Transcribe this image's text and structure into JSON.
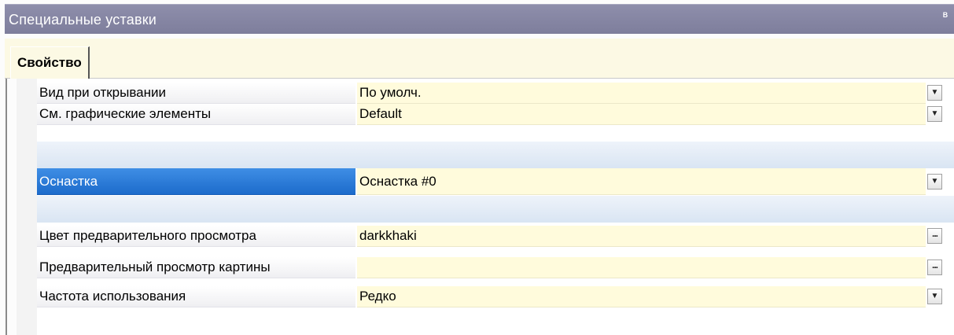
{
  "window": {
    "title": "Специальные уставки",
    "pin_icon": "pin-icon"
  },
  "tabs": [
    {
      "label": "Свойство"
    }
  ],
  "grid": {
    "rows": [
      {
        "name": "Вид при открывании",
        "value": "По умолч.",
        "button": "dropdown"
      },
      {
        "name": "См. графические элементы",
        "value": "Default",
        "button": "dropdown"
      },
      {
        "name": "Оснастка",
        "value": "Оснастка #0",
        "button": "dropdown",
        "selected": true
      },
      {
        "name": "Цвет предварительного просмотра",
        "value": "darkkhaki",
        "button": "ellipsis"
      },
      {
        "name": "Предварительный просмотр картины",
        "value": "",
        "button": "ellipsis"
      },
      {
        "name": "Частота использования",
        "value": "Редко",
        "button": "dropdown"
      }
    ]
  },
  "colors": {
    "titlebar": "#8484a2",
    "tabstrip": "#fcf9e4",
    "value_cell": "#fffbdc",
    "selected_row": "#2878d8",
    "separator": "#dfe8f4"
  }
}
